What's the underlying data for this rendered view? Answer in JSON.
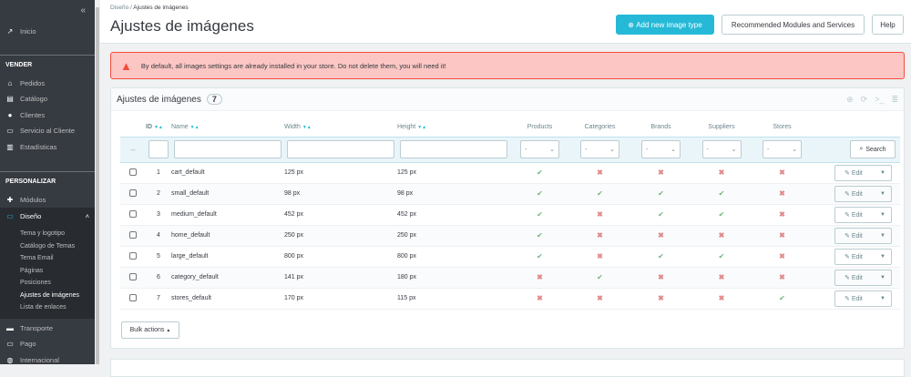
{
  "sidebar": {
    "collapse": "«",
    "inicio": "Inicio",
    "vender": "VENDER",
    "vender_items": [
      "Pedidos",
      "Catálogo",
      "Clientes",
      "Servicio al Cliente",
      "Estadísticas"
    ],
    "personalizar": "PERSONALIZAR",
    "modulos": "Módulos",
    "diseno": "Diseño",
    "diseno_sub": [
      "Tema y logotipo",
      "Catálogo de Temas",
      "Tema Email",
      "Páginas",
      "Posiciones",
      "Ajustes de imágenes",
      "Lista de enlaces"
    ],
    "after": [
      "Transporte",
      "Pago",
      "Internacional"
    ]
  },
  "header": {
    "breadcrumb": [
      "Diseño",
      "Ajustes de imágenes"
    ],
    "title": "Ajustes de imágenes",
    "add_button": "Add new image type",
    "recommended_button": "Recommended Modules and Services",
    "help_button": "Help"
  },
  "alert": "By default, all images settings are already installed in your store. Do not delete them, you will need it!",
  "panel": {
    "title": "Ajustes de imágenes",
    "count": "7",
    "search": "Search",
    "bulk": "Bulk actions",
    "edit": "Edit",
    "filter_placeholder": "-",
    "filter_dash": "--"
  },
  "columns": [
    "ID",
    "Name",
    "Width",
    "Height",
    "Products",
    "Categories",
    "Brands",
    "Suppliers",
    "Stores"
  ],
  "rows": [
    {
      "id": "1",
      "name": "cart_default",
      "width": "125 px",
      "height": "125 px",
      "flags": [
        1,
        0,
        0,
        0,
        0
      ]
    },
    {
      "id": "2",
      "name": "small_default",
      "width": "98 px",
      "height": "98 px",
      "flags": [
        1,
        1,
        1,
        1,
        0
      ]
    },
    {
      "id": "3",
      "name": "medium_default",
      "width": "452 px",
      "height": "452 px",
      "flags": [
        1,
        0,
        1,
        1,
        0
      ]
    },
    {
      "id": "4",
      "name": "home_default",
      "width": "250 px",
      "height": "250 px",
      "flags": [
        1,
        0,
        0,
        0,
        0
      ]
    },
    {
      "id": "5",
      "name": "large_default",
      "width": "800 px",
      "height": "800 px",
      "flags": [
        1,
        0,
        1,
        1,
        0
      ]
    },
    {
      "id": "6",
      "name": "category_default",
      "width": "141 px",
      "height": "180 px",
      "flags": [
        0,
        1,
        0,
        0,
        0
      ]
    },
    {
      "id": "7",
      "name": "stores_default",
      "width": "170 px",
      "height": "115 px",
      "flags": [
        0,
        0,
        0,
        0,
        1
      ]
    }
  ],
  "colors": {
    "primary": "#25b9d7",
    "yes": "#70b580",
    "no": "#e08a8a",
    "alert_bg": "#fbc6c3",
    "sidebar": "#363a41"
  }
}
